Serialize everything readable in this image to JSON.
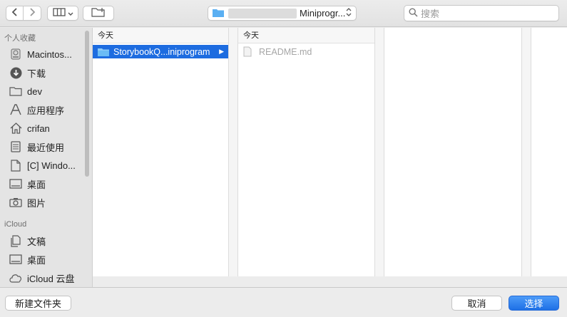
{
  "toolbar": {
    "path_label": "Miniprogr...",
    "search_placeholder": "搜索"
  },
  "sidebar": {
    "favorites_title": "个人收藏",
    "favorites": [
      {
        "label": "Macintos...",
        "icon": "disk-icon"
      },
      {
        "label": "下载",
        "icon": "download-icon"
      },
      {
        "label": "dev",
        "icon": "folder-icon"
      },
      {
        "label": "应用程序",
        "icon": "apps-icon"
      },
      {
        "label": "crifan",
        "icon": "home-icon"
      },
      {
        "label": "最近使用",
        "icon": "recents-icon"
      },
      {
        "label": "[C] Windo...",
        "icon": "document-icon"
      },
      {
        "label": "桌面",
        "icon": "desktop-icon"
      },
      {
        "label": "图片",
        "icon": "camera-icon"
      }
    ],
    "icloud_title": "iCloud",
    "icloud": [
      {
        "label": "文稿",
        "icon": "documents-icon"
      },
      {
        "label": "桌面",
        "icon": "desktop-icon"
      },
      {
        "label": "iCloud 云盘",
        "icon": "cloud-icon"
      }
    ]
  },
  "columns": [
    {
      "header": "今天",
      "items": [
        {
          "label": "StorybookQ...iniprogram",
          "selected": true
        }
      ]
    },
    {
      "header": "今天",
      "items": [
        {
          "label": "README.md",
          "selected": false
        }
      ]
    }
  ],
  "bottom": {
    "new_folder": "新建文件夹",
    "cancel": "取消",
    "choose": "选择"
  },
  "colors": {
    "accent": "#1d6ce0",
    "folder": "#5aaff2"
  }
}
